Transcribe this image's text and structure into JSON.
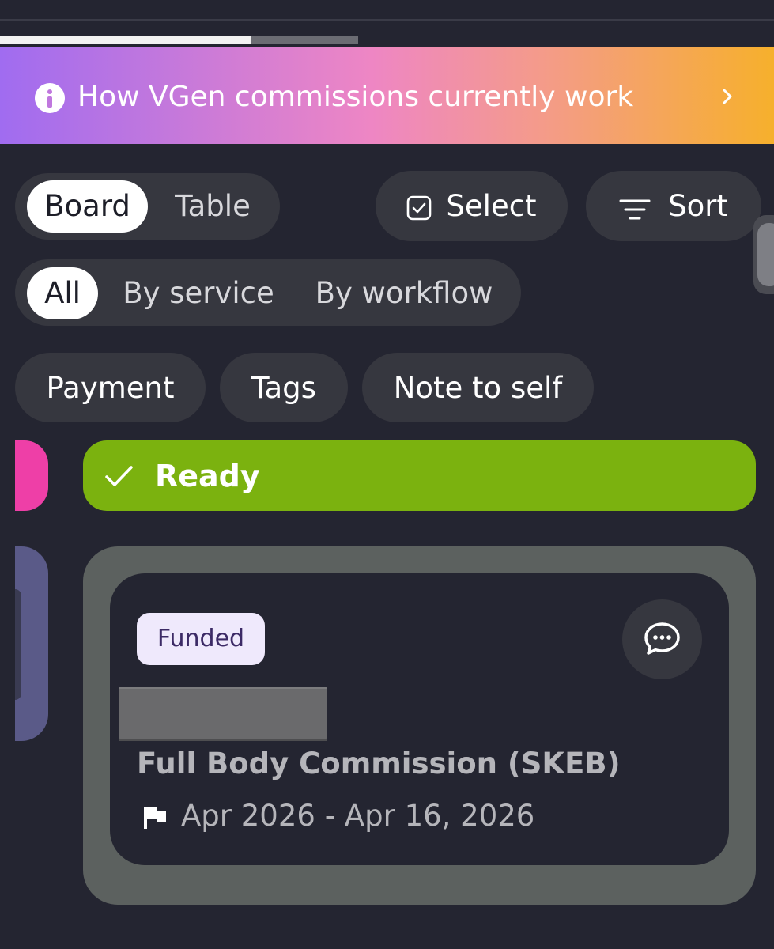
{
  "progress": {
    "fraction": 0.7
  },
  "banner": {
    "text": "How VGen commissions currently work",
    "icon": "info-icon",
    "chevron": "chevron-right-icon",
    "gradient": [
      "#a06cf0",
      "#ee86c4",
      "#f6b02c"
    ]
  },
  "view_toggle": {
    "options": [
      "Board",
      "Table"
    ],
    "selected": "Board"
  },
  "toolbar": {
    "select_label": "Select",
    "select_icon": "checkbox-icon",
    "sort_label": "Sort",
    "sort_icon": "sort-icon"
  },
  "grouping": {
    "options": [
      "All",
      "By service",
      "By workflow"
    ],
    "selected": "All"
  },
  "filters": [
    "Payment",
    "Tags",
    "Note to self"
  ],
  "column": {
    "status_label": "Ready",
    "status_icon": "check-icon",
    "status_color": "#7bb20f"
  },
  "card": {
    "badge": "Funded",
    "title": "Full Body Commission (SKEB)",
    "dates": "Apr 2026 - Apr 16, 2026",
    "chat_icon": "chat-bubble-icon",
    "flag_icon": "flag-icon"
  }
}
